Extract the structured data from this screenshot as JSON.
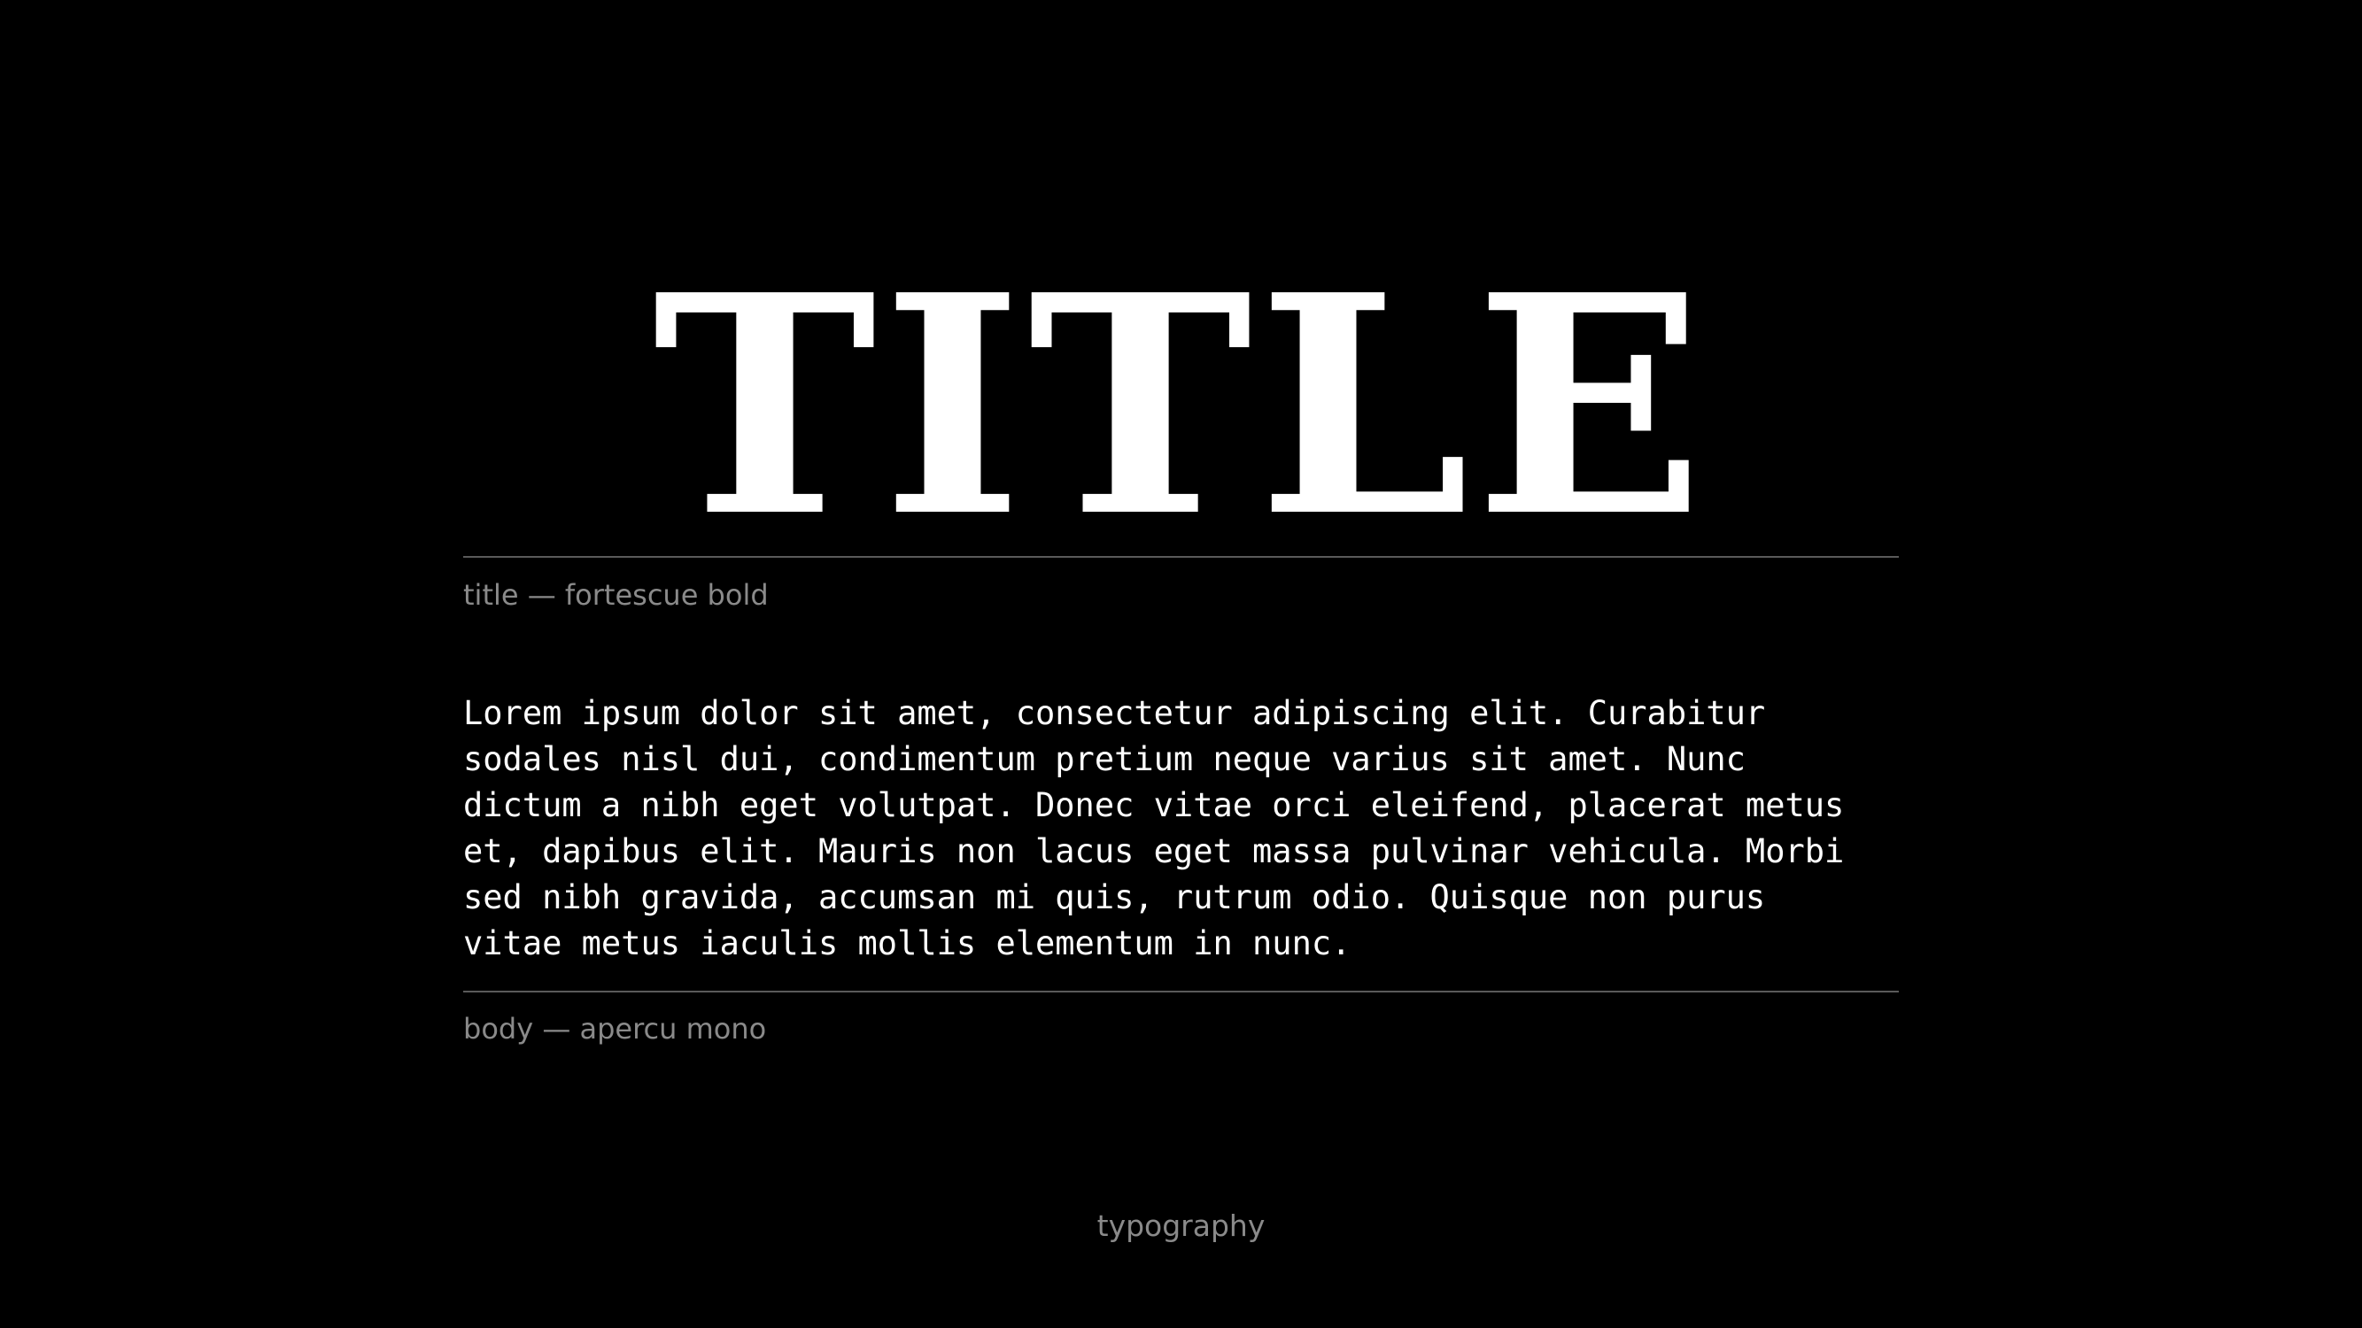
{
  "title_specimen": {
    "text": "TITLE",
    "caption": "title — fortescue bold"
  },
  "body_specimen": {
    "lines": [
      "Lorem ipsum dolor sit amet, consectetur adipiscing elit. Curabitur",
      "sodales nisl dui, condimentum pretium neque varius sit amet. Nunc",
      "dictum a nibh eget volutpat. Donec vitae orci eleifend, placerat metus",
      "et, dapibus elit. Mauris non lacus eget massa pulvinar vehicula. Morbi",
      "sed nibh gravida, accumsan mi quis, rutrum odio. Quisque non purus",
      "vitae metus iaculis mollis elementum in nunc."
    ],
    "caption": "body — apercu mono"
  },
  "footer": {
    "label": "typography"
  },
  "colors": {
    "background": "#000000",
    "text": "#ffffff",
    "caption": "#8a8a8a",
    "rule": "#5a5a5a"
  }
}
